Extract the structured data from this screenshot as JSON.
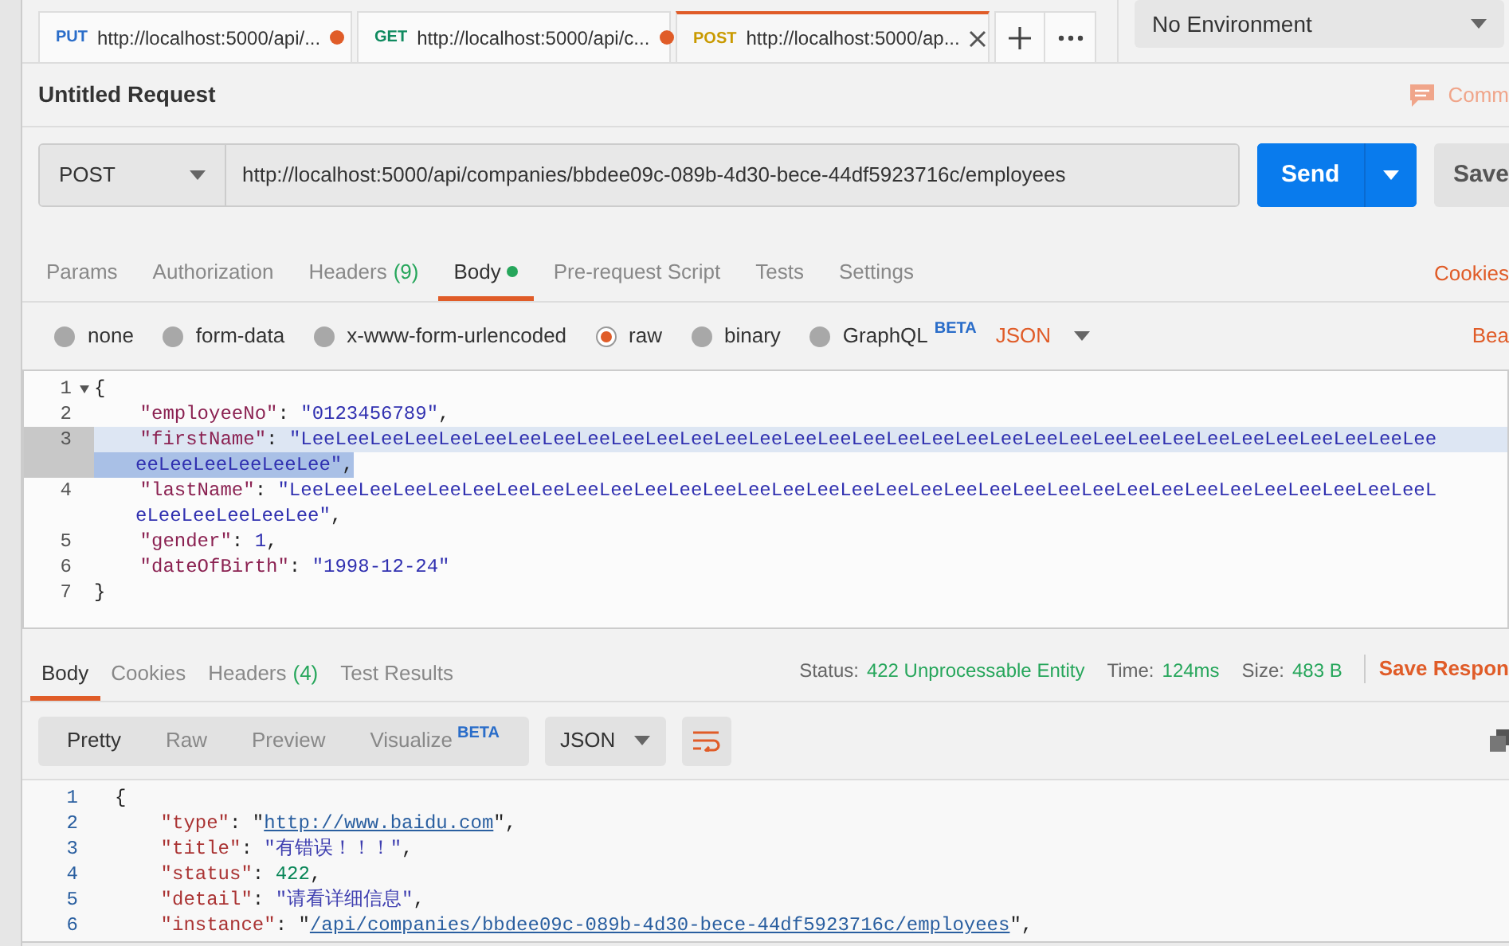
{
  "open_tabs": [
    {
      "method": "PUT",
      "url": "http://localhost:5000/api/...",
      "selected": false,
      "unsaved": true
    },
    {
      "method": "GET",
      "url": "http://localhost:5000/api/c...",
      "selected": false,
      "unsaved": true
    },
    {
      "method": "POST",
      "url": "http://localhost:5000/ap...",
      "selected": true,
      "unsaved": false
    }
  ],
  "environment": "No Environment",
  "request_title": "Untitled Request",
  "comments_label": "Comm",
  "request": {
    "method": "POST",
    "url": "http://localhost:5000/api/companies/bbdee09c-089b-4d30-bece-44df5923716c/employees",
    "send": "Send",
    "save": "Save"
  },
  "request_tabs": [
    {
      "label": "Params",
      "selected": false
    },
    {
      "label": "Authorization",
      "selected": false
    },
    {
      "label": "Headers",
      "count": "(9)",
      "selected": false
    },
    {
      "label": "Body",
      "selected": true,
      "has_content": true
    },
    {
      "label": "Pre-request Script",
      "selected": false
    },
    {
      "label": "Tests",
      "selected": false
    },
    {
      "label": "Settings",
      "selected": false
    }
  ],
  "cookies_link": "Cookies",
  "body_types": [
    {
      "label": "none",
      "selected": false
    },
    {
      "label": "form-data",
      "selected": false
    },
    {
      "label": "x-www-form-urlencoded",
      "selected": false
    },
    {
      "label": "raw",
      "selected": true
    },
    {
      "label": "binary",
      "selected": false
    },
    {
      "label": "GraphQL",
      "badge": "BETA",
      "selected": false
    }
  ],
  "body_format": "JSON",
  "beautify_link": "Bea",
  "request_body": [
    {
      "number": "1",
      "foldable": true,
      "selected": false,
      "segments": [
        {
          "kind": "punct",
          "text": "{"
        }
      ]
    },
    {
      "number": "2",
      "foldable": false,
      "selected": false,
      "segments": [
        {
          "kind": "key",
          "text": "    \"employeeNo\""
        },
        {
          "kind": "punct",
          "text": ": "
        },
        {
          "kind": "string",
          "text": "\"0123456789\""
        },
        {
          "kind": "punct",
          "text": ","
        }
      ]
    },
    {
      "number": "3",
      "foldable": false,
      "selected": true,
      "segments": [
        {
          "kind": "key",
          "text": "    \"firstName\""
        },
        {
          "kind": "punct",
          "text": ": "
        },
        {
          "kind": "string",
          "text": "\"LeeLeeLeeLeeLeeLeeLeeLeeLeeLeeLeeLeeLeeLeeLeeLeeLeeLeeLeeLeeLeeLeeLeeLeeLeeLeeLeeLeeLeeLeeLeeLeeLee"
        }
      ],
      "continuation": [
        {
          "kind": "string",
          "text": "eeLeeLeeLeeLeeLee\""
        },
        {
          "kind": "punct",
          "text": ","
        }
      ]
    },
    {
      "number": "4",
      "foldable": false,
      "selected": false,
      "segments": [
        {
          "kind": "key",
          "text": "    \"lastName\""
        },
        {
          "kind": "punct",
          "text": ": "
        },
        {
          "kind": "string",
          "text": "\"LeeLeeLeeLeeLeeLeeLeeLeeLeeLeeLeeLeeLeeLeeLeeLeeLeeLeeLeeLeeLeeLeeLeeLeeLeeLeeLeeLeeLeeLeeLeeLeeLeeL"
        }
      ],
      "continuation": [
        {
          "kind": "string",
          "text": "eLeeLeeLeeLeeLee\""
        },
        {
          "kind": "punct",
          "text": ","
        }
      ]
    },
    {
      "number": "5",
      "foldable": false,
      "selected": false,
      "segments": [
        {
          "kind": "key",
          "text": "    \"gender\""
        },
        {
          "kind": "punct",
          "text": ": "
        },
        {
          "kind": "string",
          "text": "1"
        },
        {
          "kind": "punct",
          "text": ","
        }
      ]
    },
    {
      "number": "6",
      "foldable": false,
      "selected": false,
      "segments": [
        {
          "kind": "key",
          "text": "    \"dateOfBirth\""
        },
        {
          "kind": "punct",
          "text": ": "
        },
        {
          "kind": "string",
          "text": "\"1998-12-24\""
        }
      ]
    },
    {
      "number": "7",
      "foldable": false,
      "selected": false,
      "segments": [
        {
          "kind": "punct",
          "text": "}"
        }
      ]
    }
  ],
  "response_tabs": [
    {
      "label": "Body",
      "selected": true
    },
    {
      "label": "Cookies",
      "selected": false
    },
    {
      "label": "Headers",
      "count": "(4)",
      "selected": false
    },
    {
      "label": "Test Results",
      "selected": false
    }
  ],
  "response_stats": [
    {
      "label": "Status:",
      "value": "422 Unprocessable Entity"
    },
    {
      "label": "Time:",
      "value": "124ms"
    },
    {
      "label": "Size:",
      "value": "483 B"
    }
  ],
  "save_response": "Save Respon",
  "view_modes": [
    {
      "label": "Pretty",
      "selected": true
    },
    {
      "label": "Raw",
      "selected": false
    },
    {
      "label": "Preview",
      "selected": false
    },
    {
      "label": "Visualize",
      "badge": "BETA",
      "selected": false
    }
  ],
  "response_format": "JSON",
  "response_body": [
    {
      "number": "1",
      "segments": [
        {
          "kind": "punct",
          "text": "{"
        }
      ]
    },
    {
      "number": "2",
      "segments": [
        {
          "kind": "key",
          "text": "    \"type\""
        },
        {
          "kind": "punct",
          "text": ": "
        },
        {
          "kind": "punct",
          "text": "\""
        },
        {
          "kind": "link",
          "text": "http://www.baidu.com"
        },
        {
          "kind": "punct",
          "text": "\","
        }
      ]
    },
    {
      "number": "3",
      "segments": [
        {
          "kind": "key",
          "text": "    \"title\""
        },
        {
          "kind": "punct",
          "text": ": "
        },
        {
          "kind": "string",
          "text": "\"有错误！！！\""
        },
        {
          "kind": "punct",
          "text": ","
        }
      ]
    },
    {
      "number": "4",
      "segments": [
        {
          "kind": "key",
          "text": "    \"status\""
        },
        {
          "kind": "punct",
          "text": ": "
        },
        {
          "kind": "number",
          "text": "422"
        },
        {
          "kind": "punct",
          "text": ","
        }
      ]
    },
    {
      "number": "5",
      "segments": [
        {
          "kind": "key",
          "text": "    \"detail\""
        },
        {
          "kind": "punct",
          "text": ": "
        },
        {
          "kind": "string",
          "text": "\"请看详细信息\""
        },
        {
          "kind": "punct",
          "text": ","
        }
      ]
    },
    {
      "number": "6",
      "segments": [
        {
          "kind": "key",
          "text": "    \"instance\""
        },
        {
          "kind": "punct",
          "text": ": "
        },
        {
          "kind": "punct",
          "text": "\""
        },
        {
          "kind": "link",
          "text": "/api/companies/bbdee09c-089b-4d30-bece-44df5923716c/employees"
        },
        {
          "kind": "punct",
          "text": "\","
        }
      ]
    }
  ]
}
